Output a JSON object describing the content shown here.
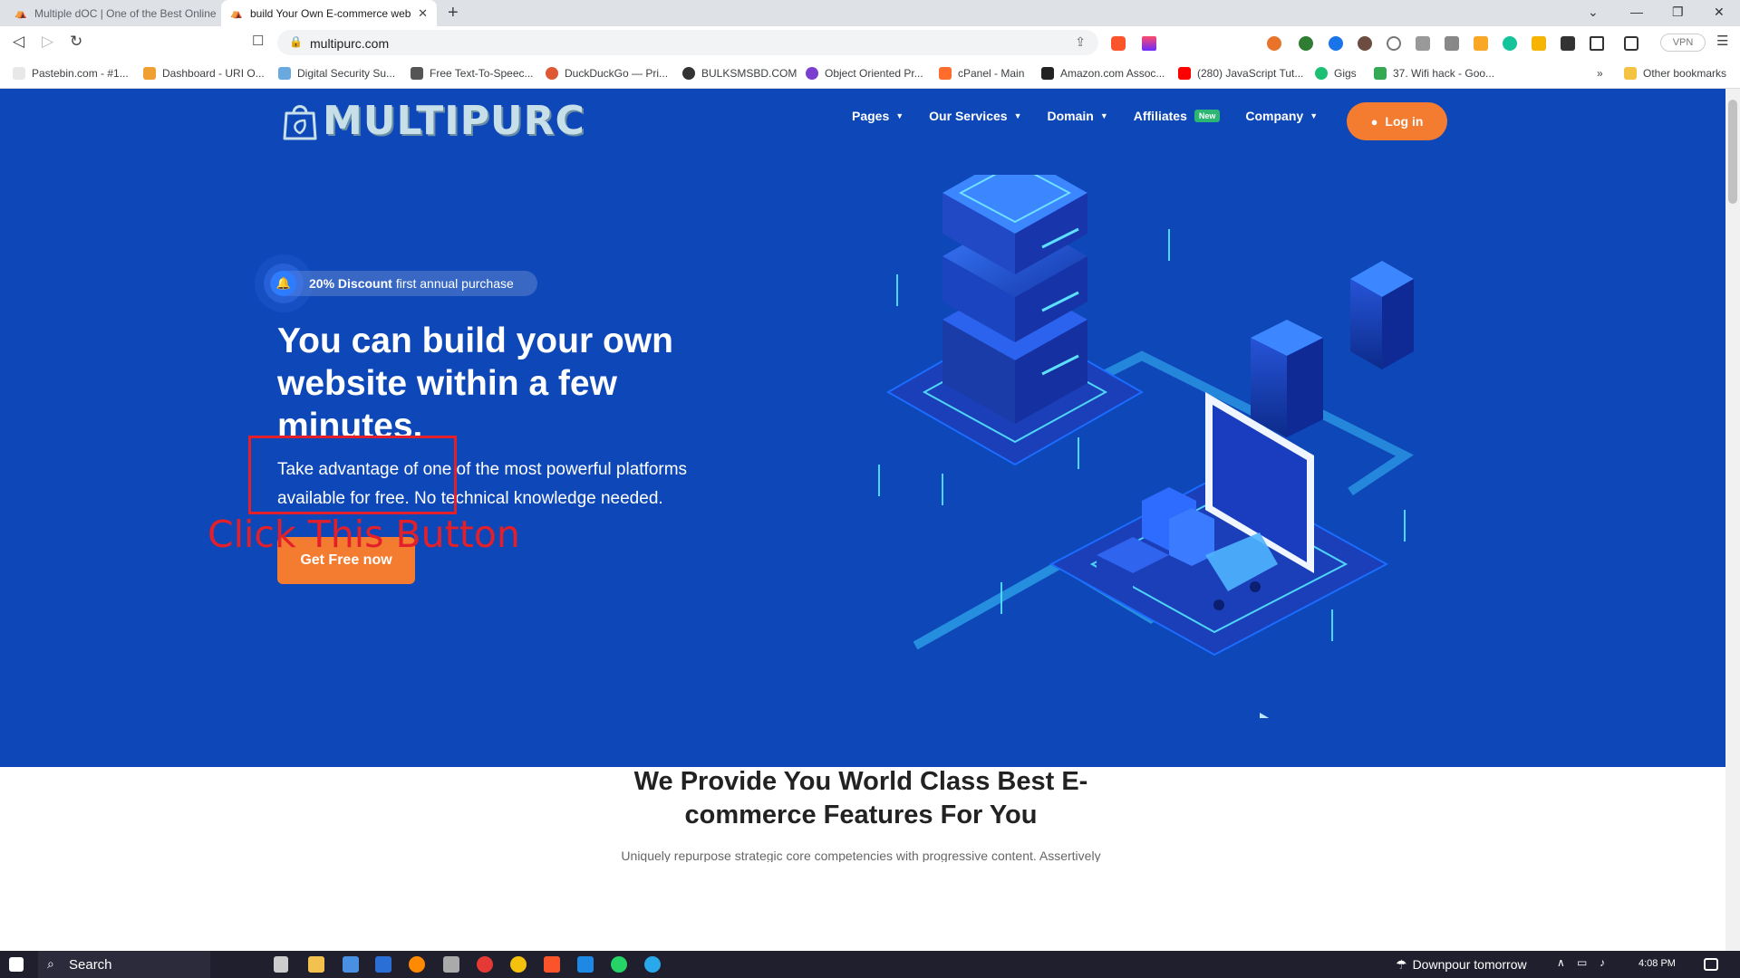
{
  "browser": {
    "tabs": [
      {
        "title": "Multiple dOC | One of the Best Online",
        "active": false
      },
      {
        "title": "build Your Own E-commerce web",
        "active": true
      }
    ],
    "new_tab": "+",
    "url": "multipurc.com",
    "vpn_label": "VPN",
    "bookmarks": [
      {
        "label": "Pastebin.com - #1...",
        "color": "#e8e8e8"
      },
      {
        "label": "Dashboard - URI O...",
        "color": "#f0a030"
      },
      {
        "label": "Digital Security Su...",
        "color": "#6aa9e0"
      },
      {
        "label": "Free Text-To-Speec...",
        "color": "#555555"
      },
      {
        "label": "DuckDuckGo — Pri...",
        "color": "#de5833"
      },
      {
        "label": "BULKSMSBD.COM",
        "color": "#333333"
      },
      {
        "label": "Object Oriented Pr...",
        "color": "#7b3fd0"
      },
      {
        "label": "cPanel - Main",
        "color": "#ff6c2c"
      },
      {
        "label": "Amazon.com Assoc...",
        "color": "#222222"
      },
      {
        "label": "(280) JavaScript Tut...",
        "color": "#ff0000"
      },
      {
        "label": "Gigs",
        "color": "#1dbf73"
      },
      {
        "label": "37. Wifi hack - Goo...",
        "color": "#34a853"
      }
    ],
    "other_bookmarks": "Other bookmarks"
  },
  "site": {
    "logo_text": "MULTIPURC",
    "menu": [
      {
        "label": "Pages",
        "dropdown": true
      },
      {
        "label": "Our Services",
        "dropdown": true
      },
      {
        "label": "Domain",
        "dropdown": true
      },
      {
        "label": "Affiliates",
        "badge": "New"
      },
      {
        "label": "Company",
        "dropdown": true
      }
    ],
    "login_label": "Log in",
    "discount_bold": "20% Discount",
    "discount_rest": "first annual purchase",
    "headline": "You can build your own website within a few minutes.",
    "subtext": "Take advantage of one of the most powerful platforms available for free. No technical knowledge needed.",
    "cta_label": "Get Free now",
    "annotation": "Click This Button",
    "section2_title": "We Provide You World Class Best E-commerce Features For You",
    "section2_sub": "Uniquely repurpose strategic core competencies with progressive content. Assertively"
  },
  "taskbar": {
    "search_label": "Search",
    "weather": "Downpour tomorrow",
    "time": "4:08 PM"
  },
  "colors": {
    "hero_bg": "#0d47b8",
    "accent_orange": "#f47c30",
    "annotation_red": "#e3202a",
    "new_badge": "#2bb673"
  }
}
